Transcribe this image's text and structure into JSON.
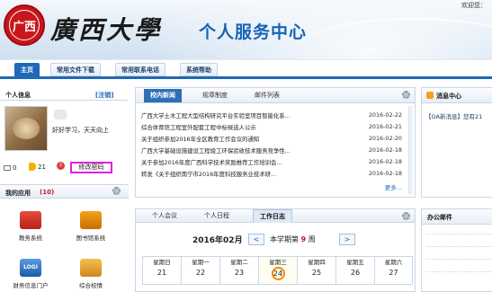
{
  "header": {
    "logo_text": "广西",
    "brand": "廣西大學",
    "service_title": "个人服务中心",
    "welcome": "欢迎您："
  },
  "nav": {
    "items": [
      {
        "label": "主页"
      },
      {
        "label": "常用文件下载"
      },
      {
        "label": "常用联系电话"
      },
      {
        "label": "系统帮助"
      }
    ]
  },
  "profile": {
    "title": "个人信息",
    "logout": "[注销]",
    "status": "好好学习，天天向上",
    "mail_count": "0",
    "notice_count": "21",
    "msg_count": "2",
    "change_password": "修改密码"
  },
  "apps": {
    "title": "我的应用",
    "count": "(10)",
    "items": [
      {
        "label": "教务系统"
      },
      {
        "label": "图书馆系统"
      },
      {
        "label": "财务信息门户"
      },
      {
        "label": "综合校情"
      }
    ],
    "logi_text": "LOGI"
  },
  "news": {
    "tabs": [
      {
        "label": "校内新闻"
      },
      {
        "label": "规章制度"
      },
      {
        "label": "邮件列表"
      }
    ],
    "items": [
      {
        "title": "广西大学土木工程大型结构研究平台实验室项目智能化系...",
        "date": "2016-02-22"
      },
      {
        "title": "综合体育馆工程室外配套工程中标候选人公示",
        "date": "2016-02-21"
      },
      {
        "title": "关于组织参加2016年全区教育工作会议的通知",
        "date": "2016-02-20"
      },
      {
        "title": "广西大学基础设施建设工程竣工环保验收技术服务竞争性...",
        "date": "2016-02-18"
      },
      {
        "title": "关于参加2016年度广西科学技术奖励推荐工作培训会...",
        "date": "2016-02-18"
      },
      {
        "title": "转发《关于组织南宁市2016年度科技服务业技术研...",
        "date": "2016-02-18"
      }
    ],
    "more": "更多..."
  },
  "messages": {
    "title": "消息中心",
    "item": "【OA新消息】您有21"
  },
  "calendar": {
    "tabs": [
      {
        "label": "个人会议"
      },
      {
        "label": "个人日程"
      },
      {
        "label": "工作日志"
      }
    ],
    "month": "2016年02月",
    "prev": "<",
    "next": ">",
    "week_prefix": "本学期第",
    "week_num": "9",
    "week_suffix": "周",
    "days": [
      {
        "name": "星期日",
        "num": "21"
      },
      {
        "name": "星期一",
        "num": "22"
      },
      {
        "name": "星期二",
        "num": "23"
      },
      {
        "name": "星期三",
        "num": "24"
      },
      {
        "name": "星期四",
        "num": "25"
      },
      {
        "name": "星期五",
        "num": "26"
      },
      {
        "name": "星期六",
        "num": "27"
      }
    ]
  },
  "office_mail": {
    "title": "办公邮件"
  },
  "colors": {
    "brand_blue": "#1e69b8",
    "accent_red": "#c8161d",
    "highlight_magenta": "#e020e0"
  }
}
